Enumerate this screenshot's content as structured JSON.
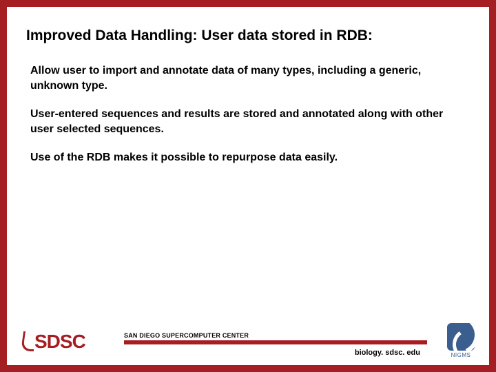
{
  "slide": {
    "title": "Improved Data Handling: User data stored in RDB:",
    "paragraphs": [
      "Allow user to import and annotate data of many types, including a generic, unknown type.",
      "User-entered sequences and results are stored and annotated along with other user selected sequences.",
      "Use of the RDB makes it possible to repurpose data easily."
    ]
  },
  "footer": {
    "sdsc_text": "SDSC",
    "center_label": "SAN DIEGO SUPERCOMPUTER CENTER",
    "url": "biology. sdsc. edu",
    "nigms_label": "NIGMS"
  },
  "colors": {
    "brand_red": "#a51e22",
    "nigms_blue": "#3a5f8f"
  }
}
